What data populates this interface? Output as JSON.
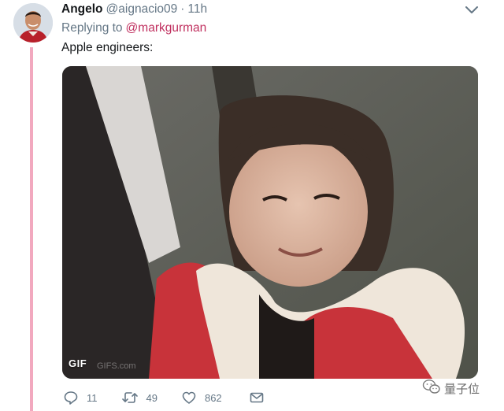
{
  "tweet": {
    "author_name": "Angelo",
    "author_handle": "@aignacio09",
    "separator": "·",
    "time": "11h",
    "replying_label": "Replying to",
    "replying_to": "@markgurman",
    "text": "Apple engineers:"
  },
  "media": {
    "badge": "GIF",
    "watermark_small": "GIFS.com"
  },
  "actions": {
    "replies": "11",
    "retweets": "49",
    "likes": "862"
  },
  "watermark": {
    "label": "量子位"
  },
  "colors": {
    "thread_line": "#f2a9bf",
    "mention": "#c0305f",
    "secondary_text": "#657786"
  },
  "icons": [
    "reply-icon",
    "retweet-icon",
    "like-icon",
    "message-icon",
    "chevron-down-icon",
    "wechat-icon"
  ]
}
